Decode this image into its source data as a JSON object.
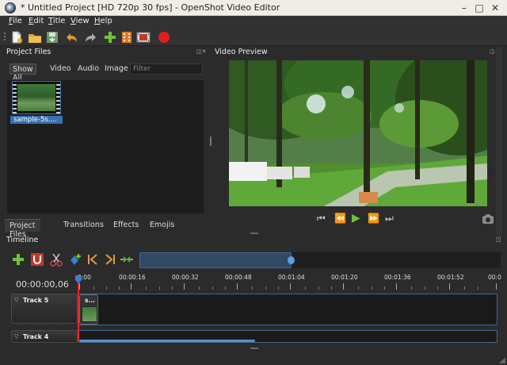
{
  "window": {
    "title": "* Untitled Project [HD 720p 30 fps] - OpenShot Video Editor",
    "minimize": "–",
    "maximize": "□",
    "close": "✕"
  },
  "menu": [
    "File",
    "Edit",
    "Title",
    "View",
    "Help"
  ],
  "toolbar_icons": [
    "new-project-icon",
    "open-project-icon",
    "save-project-icon",
    "undo-icon",
    "redo-icon",
    "import-files-icon",
    "profile-icon",
    "export-video-icon",
    "record-icon"
  ],
  "project_files": {
    "header": "Project Files",
    "filters": [
      "Show All",
      "Video",
      "Audio",
      "Image"
    ],
    "filter_placeholder": "Filter",
    "files": [
      {
        "label": "sample-5s...."
      }
    ]
  },
  "bottom_tabs": [
    "Project Files",
    "Transitions",
    "Effects",
    "Emojis"
  ],
  "preview": {
    "header": "Video Preview"
  },
  "timeline": {
    "header": "Timeline",
    "time": "00:00:00,06",
    "ticks": [
      "0:00",
      "00:00:16",
      "00:00:32",
      "00:00:48",
      "00:01:04",
      "00:01:20",
      "00:01:36",
      "00:01:52",
      "00:0"
    ],
    "tracks": [
      {
        "name": "Track 5",
        "clip_label": "s..."
      },
      {
        "name": "Track 4"
      }
    ]
  },
  "colors": {
    "accent": "#3a6fae",
    "playhead": "#ee2233",
    "play": "#6fbf3a"
  }
}
